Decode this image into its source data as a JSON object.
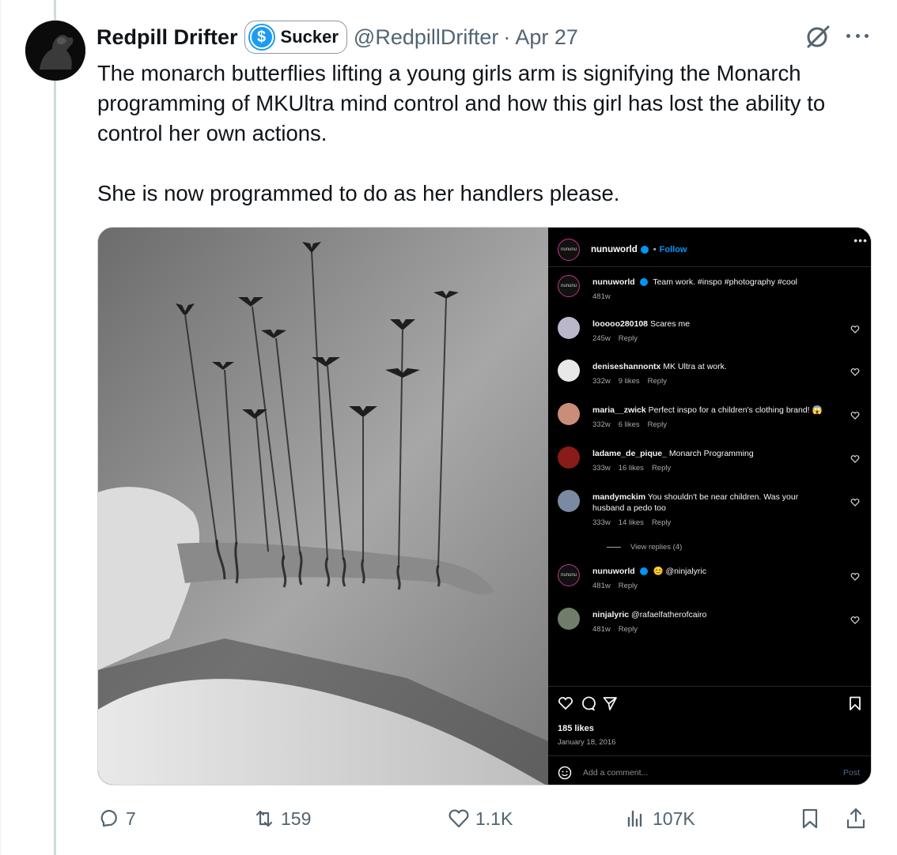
{
  "author": {
    "name": "Redpill Drifter",
    "badge_label": "Sucker",
    "badge_icon": "dollar-coin-icon",
    "handle": "@RedpillDrifter",
    "separator": "·",
    "date": "Apr 27"
  },
  "tweet": {
    "paragraphs": [
      "The monarch butterflies lifting a young girls arm is signifying the Monarch programming of MKUltra mind control and how this girl has lost the ability to control her own actions.",
      "She is now programmed to do as her handlers please."
    ]
  },
  "instagram": {
    "account": "nunuworld",
    "account_avatar_text": "nununu",
    "follow_label": "Follow",
    "follow_sep": "•",
    "more_label": "•••",
    "comments": [
      {
        "user": "nunuworld",
        "text": "Team work. #inspo #photography #cool",
        "age": "481w",
        "likes": "",
        "reply": "",
        "avatar": "nununu",
        "avatar_color": "#111111"
      },
      {
        "user": "looooo280108",
        "text": "Scares me",
        "age": "245w",
        "likes": "",
        "reply": "Reply",
        "avatar": "",
        "avatar_color": "#b9b7c9"
      },
      {
        "user": "deniseshannontx",
        "text": "MK Ultra at work.",
        "age": "332w",
        "likes": "9 likes",
        "reply": "Reply",
        "avatar": "",
        "avatar_color": "#e8e8e8"
      },
      {
        "user": "maria__zwick",
        "text": "Perfect inspo for a children's clothing brand! 😱",
        "age": "332w",
        "likes": "6 likes",
        "reply": "Reply",
        "avatar": "",
        "avatar_color": "#c98d7a"
      },
      {
        "user": "ladame_de_pique_",
        "text": "Monarch Programming",
        "age": "333w",
        "likes": "16 likes",
        "reply": "Reply",
        "avatar": "",
        "avatar_color": "#8a1b1b"
      },
      {
        "user": "mandymckim",
        "text": "You shouldn't be near children. Was your husband a pedo too",
        "age": "333w",
        "likes": "14 likes",
        "reply": "Reply",
        "avatar": "",
        "avatar_color": "#7a8aa0"
      },
      {
        "user": "nunuworld",
        "text": "😊 @ninjalyric",
        "age": "481w",
        "likes": "",
        "reply": "Reply",
        "avatar": "nununu",
        "avatar_color": "#111111"
      },
      {
        "user": "ninjalyric",
        "text": "@rafaelfatherofcairo",
        "age": "481w",
        "likes": "",
        "reply": "Reply",
        "avatar": "",
        "avatar_color": "#6f7d6a"
      }
    ],
    "view_replies": "View replies (4)",
    "likes": "185 likes",
    "post_date": "January 18, 2016",
    "add_comment_placeholder": "Add a comment...",
    "post_label": "Post",
    "action_icons": [
      "heart-icon",
      "comment-icon",
      "share-icon",
      "bookmark-icon"
    ]
  },
  "actions": {
    "replies": "7",
    "retweets": "159",
    "likes": "1.1K",
    "views": "107K"
  },
  "colors": {
    "accent": "#1d9bf0",
    "secondary_text": "#536471",
    "ig_link": "#0095f6"
  }
}
